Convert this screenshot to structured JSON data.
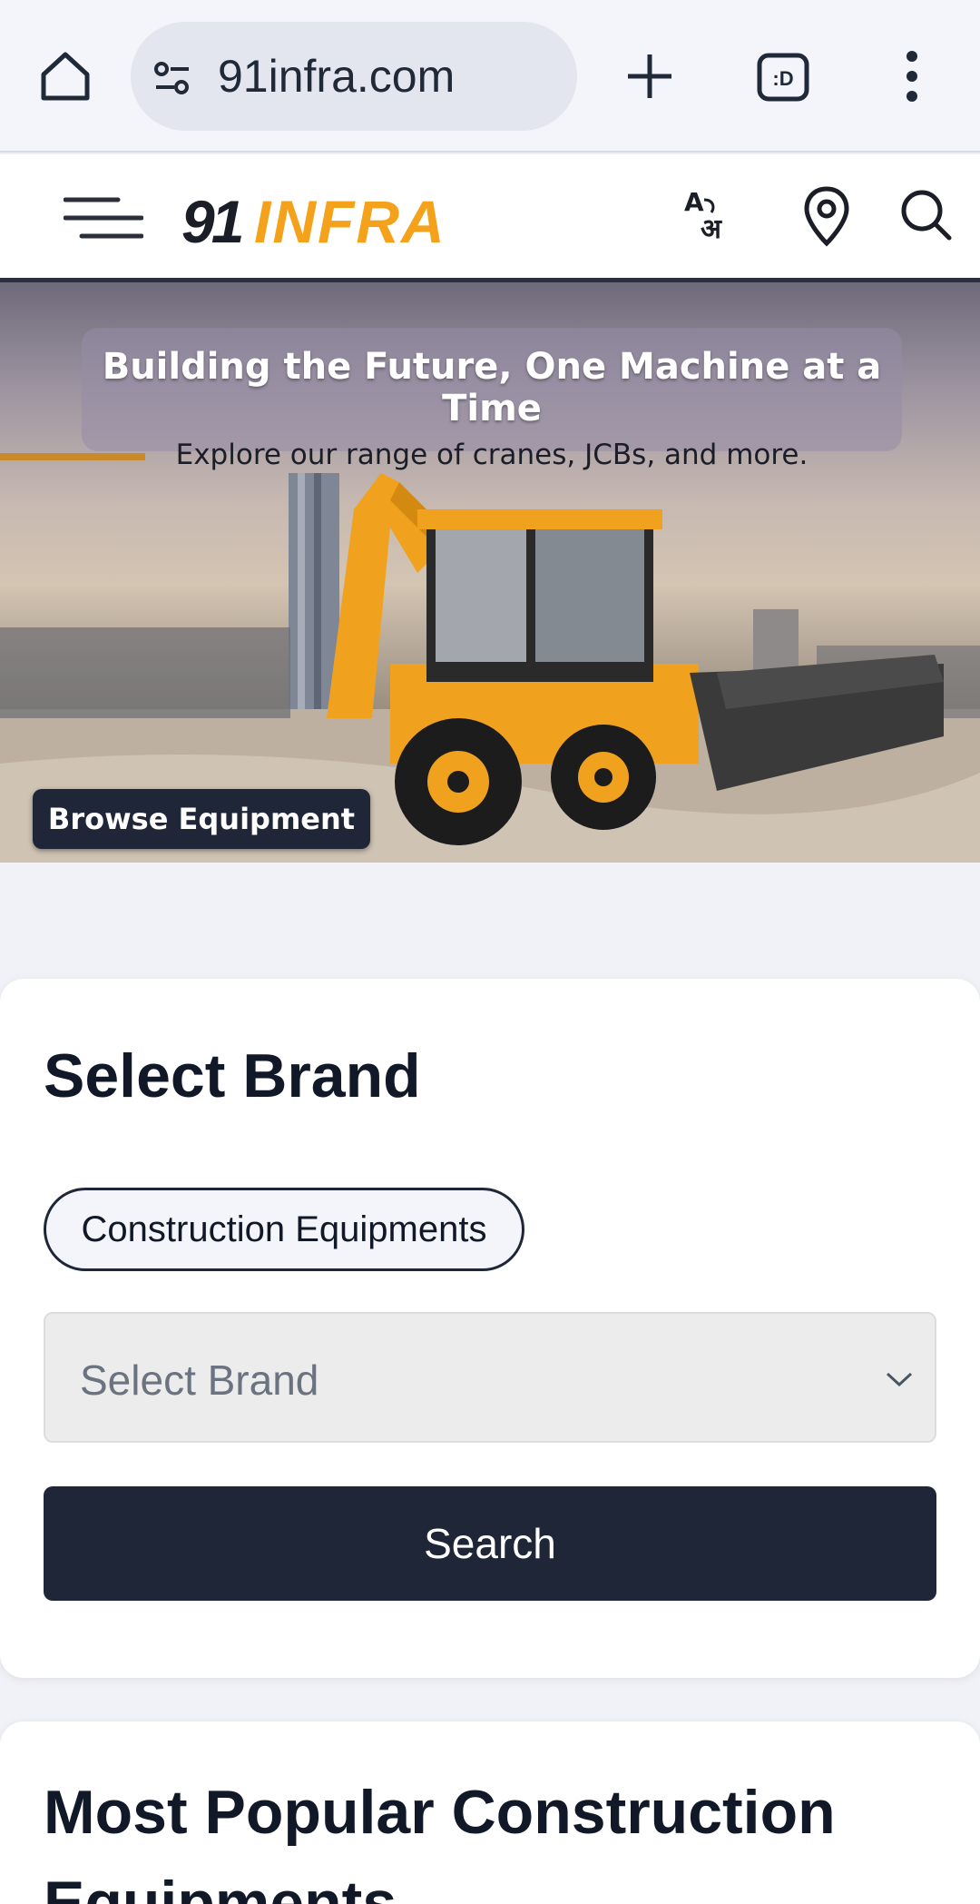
{
  "browser": {
    "url": "91infra.com",
    "tab_label": ":D"
  },
  "header": {
    "logo_number": "91",
    "logo_brand": "INFRA"
  },
  "hero": {
    "heading": "Building the Future, One Machine at a Time",
    "subheading": "Explore our range of cranes, JCBs, and more.",
    "cta_label": "Browse Equipment"
  },
  "brand_selector": {
    "title": "Select Brand",
    "category_chip": "Construction Equipments",
    "select_placeholder": "Select Brand",
    "search_label": "Search"
  },
  "popular": {
    "title": "Most Popular Construction Equipments"
  },
  "colors": {
    "accent_orange": "#f4a21b",
    "dark_navy": "#1e2637"
  }
}
